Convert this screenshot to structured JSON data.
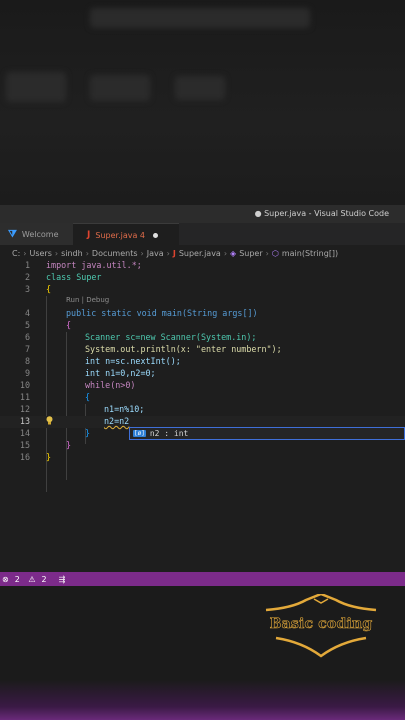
{
  "window": {
    "title": "● Super.java - Visual Studio Code"
  },
  "tabs": [
    {
      "label": "Welcome"
    },
    {
      "label": "Super.java 4"
    }
  ],
  "breadcrumb": {
    "parts": [
      "C:",
      "Users",
      "sindh",
      "Documents",
      "Java",
      "Super.java",
      "Super",
      "main(String[])"
    ]
  },
  "codelens": "Run | Debug",
  "lines": [
    {
      "n": "1",
      "text": "import java.util.*;"
    },
    {
      "n": "2",
      "text": "class Super"
    },
    {
      "n": "3",
      "text": "{"
    },
    {
      "n": "4",
      "text": "public static void main(String args[])"
    },
    {
      "n": "5",
      "text": "{"
    },
    {
      "n": "6",
      "text": "Scanner sc=new Scanner(System.in);"
    },
    {
      "n": "7",
      "text": "System.out.println(x: \"enter numbern\");"
    },
    {
      "n": "8",
      "text": "int n=sc.nextInt();"
    },
    {
      "n": "9",
      "text": "int n1=0,n2=0;"
    },
    {
      "n": "10",
      "text": "while(n>0)"
    },
    {
      "n": "11",
      "text": "{"
    },
    {
      "n": "12",
      "text": "n1=n%10;"
    },
    {
      "n": "13",
      "text": "n2=n2"
    },
    {
      "n": "14",
      "text": "}"
    },
    {
      "n": "15",
      "text": "}"
    },
    {
      "n": "16",
      "text": "}"
    }
  ],
  "suggestion": {
    "text": "n2 : int"
  },
  "status": {
    "errors": "2",
    "warnings": "2"
  },
  "watermark": {
    "text": "Basic coding"
  }
}
